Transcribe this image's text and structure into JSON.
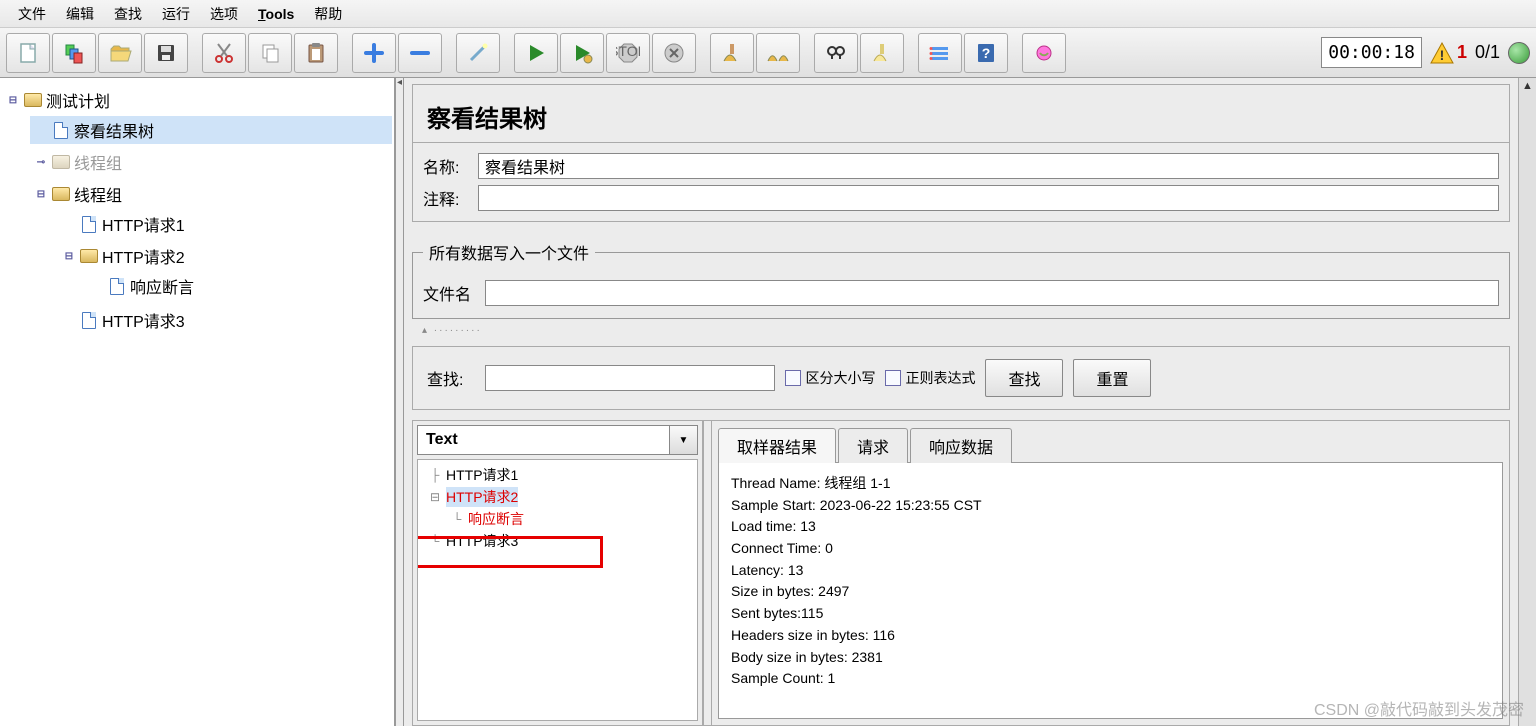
{
  "menu": [
    "文件",
    "编辑",
    "查找",
    "运行",
    "选项",
    "Tools",
    "帮助"
  ],
  "toolbar": {
    "icons": [
      "new-file-icon",
      "templates-icon",
      "open-icon",
      "save-icon",
      "sep",
      "cut-icon",
      "copy-icon",
      "paste-icon",
      "sep",
      "plus-icon",
      "minus-icon",
      "sep",
      "wand-icon",
      "sep",
      "start-icon",
      "start-no-timer-icon",
      "stop-icon",
      "shutdown-icon",
      "sep",
      "clear-icon",
      "clear-all-icon",
      "sep",
      "search-icon",
      "reset-search-icon",
      "sep",
      "function-icon",
      "help-icon",
      "sep",
      "ssl-icon"
    ]
  },
  "timer": "00:00:18",
  "error_count": "1",
  "thread_count": "0/1",
  "left_tree": {
    "root": "测试计划",
    "nodes": [
      {
        "label": "察看结果树",
        "icon": "doc",
        "selected": true
      },
      {
        "label": "线程组",
        "icon": "folder",
        "disabled": true
      },
      {
        "label": "线程组",
        "icon": "folder",
        "children": [
          {
            "label": "HTTP请求1",
            "icon": "doc"
          },
          {
            "label": "HTTP请求2",
            "icon": "folder",
            "children": [
              {
                "label": "响应断言",
                "icon": "doc"
              }
            ]
          },
          {
            "label": "HTTP请求3",
            "icon": "doc"
          }
        ]
      }
    ]
  },
  "panel": {
    "title": "察看结果树",
    "name_label": "名称:",
    "name_value": "察看结果树",
    "comment_label": "注释:",
    "file_group_legend": "所有数据写入一个文件",
    "filename_label": "文件名"
  },
  "search": {
    "label": "查找:",
    "case_label": "区分大小写",
    "regex_label": "正则表达式",
    "search_btn": "查找",
    "reset_btn": "重置"
  },
  "results": {
    "dropdown": "Text",
    "tree": [
      {
        "label": "HTTP请求1"
      },
      {
        "label": "HTTP请求2",
        "red": true,
        "selected": true,
        "children": [
          {
            "label": "响应断言",
            "red": true
          }
        ]
      },
      {
        "label": "HTTP请求3",
        "highlight_box": true
      }
    ],
    "tabs": [
      "取样器结果",
      "请求",
      "响应数据"
    ],
    "active_tab": 0,
    "content": [
      "Thread Name: 线程组 1-1",
      "Sample Start: 2023-06-22 15:23:55 CST",
      "Load time: 13",
      "Connect Time: 0",
      "Latency: 13",
      "Size in bytes: 2497",
      "Sent bytes:115",
      "Headers size in bytes: 116",
      "Body size in bytes: 2381",
      "Sample Count: 1"
    ]
  },
  "watermark": "CSDN @敲代码敲到头发茂密"
}
